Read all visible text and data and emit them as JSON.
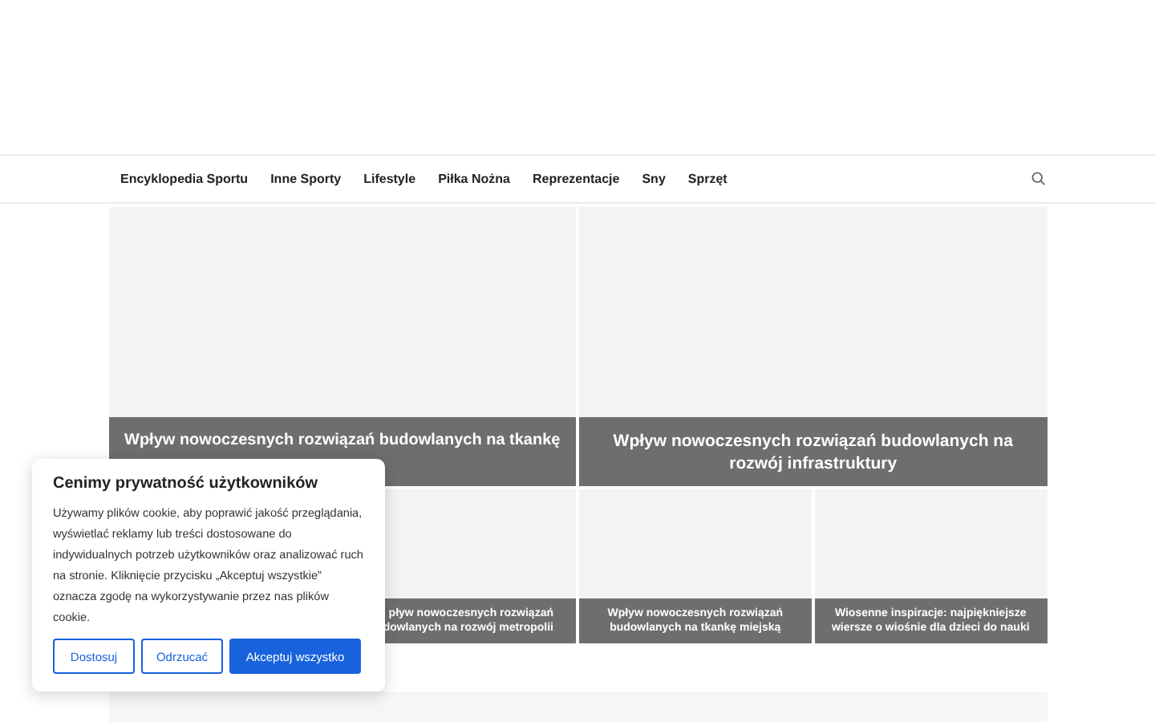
{
  "nav": {
    "items": [
      {
        "label": "Encyklopedia Sportu"
      },
      {
        "label": "Inne Sporty"
      },
      {
        "label": "Lifestyle"
      },
      {
        "label": "Piłka Nożna"
      },
      {
        "label": "Reprezentacje"
      },
      {
        "label": "Sny"
      },
      {
        "label": "Sprzęt"
      }
    ]
  },
  "featured": [
    {
      "title": "Wpływ nowoczesnych rozwiązań budowlanych na tkankę"
    },
    {
      "title": "Wpływ nowoczesnych rozwiązań budowlanych na rozwój infrastruktury"
    }
  ],
  "small_posts": [
    {
      "title_lines": [
        "pływ nowoczesnych rozwiązań",
        "dowlanych na rozwój metropolii"
      ]
    },
    {
      "title": "Wpływ nowoczesnych rozwiązań budowlanych na tkankę miejską"
    },
    {
      "title": "Wiosenne inspiracje: najpiękniejsze wiersze o wiośnie dla dzieci do nauki"
    }
  ],
  "cookie_banner": {
    "title": "Cenimy prywatność użytkowników",
    "text": "Używamy plików cookie, aby poprawić jakość przeglądania, wyświetlać reklamy lub treści dostosowane do indywidualnych potrzeb użytkowników oraz analizować ruch na stronie. Kliknięcie przycisku „Akceptuj wszystkie” oznacza zgodę na wykorzystywanie przez nas plików cookie.",
    "buttons": [
      {
        "label": "Dostosuj",
        "kind": "outline"
      },
      {
        "label": "Odrzucać",
        "kind": "outline"
      },
      {
        "label": "Akceptuj wszystko",
        "kind": "primary"
      }
    ]
  }
}
